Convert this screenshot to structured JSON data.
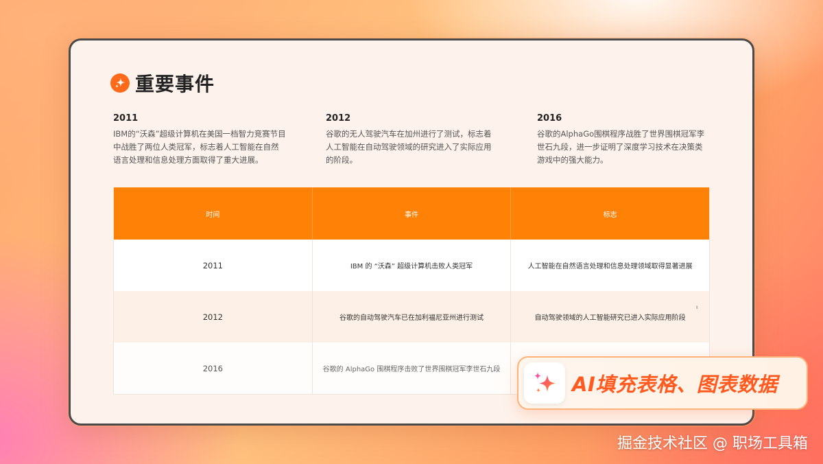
{
  "page_title": "重要事件",
  "events": [
    {
      "year": "2011",
      "description": "IBM的“沃森”超级计算机在美国一档智力竞赛节目中战胜了两位人类冠军，标志着人工智能在自然语言处理和信息处理方面取得了重大进展。"
    },
    {
      "year": "2012",
      "description": "谷歌的无人驾驶汽车在加州进行了测试，标志着人工智能在自动驾驶领域的研究进入了实际应用的阶段。"
    },
    {
      "year": "2016",
      "description": "谷歌的AlphaGo围棋程序战胜了世界围棋冠军李世石九段，进一步证明了深度学习技术在决策类游戏中的强大能力。"
    }
  ],
  "table": {
    "headers": [
      "时间",
      "事件",
      "标志"
    ],
    "rows": [
      [
        "2011",
        "IBM 的 “沃森” 超级计算机击败人类冠军",
        "人工智能在自然语言处理和信息处理领域取得显著进展"
      ],
      [
        "2012",
        "谷歌的自动驾驶汽车已在加利福尼亚州进行测试",
        "自动驾驶领域的人工智能研究已进入实际应用阶段"
      ],
      [
        "2016",
        "谷歌的 AlphaGo 围棋程序击败了世界围棋冠军李世石九段",
        ""
      ]
    ],
    "stray_mark": "ı"
  },
  "overlay": {
    "ai_label": "AI填充表格、图表数据",
    "icon": "sparkle-icon"
  },
  "watermark": "掘金技术社区 @ 职场工具箱",
  "colors": {
    "accent": "#ff8207",
    "accent_text": "#ff5a1f",
    "row_alt": "#fdf0e6"
  }
}
